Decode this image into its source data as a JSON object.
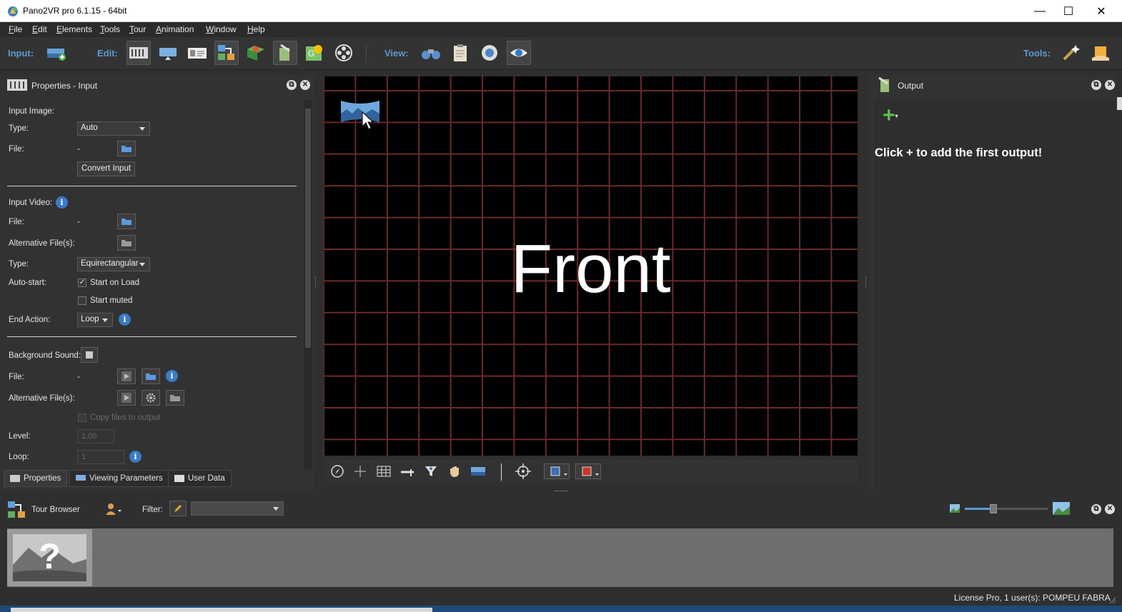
{
  "window": {
    "title": "Pano2VR pro 6.1.15 - 64bit",
    "minimize": "—",
    "maximize": "☐",
    "close": "✕"
  },
  "menu": [
    "File",
    "Edit",
    "Elements",
    "Tools",
    "Tour",
    "Animation",
    "Window",
    "Help"
  ],
  "toolbar": {
    "input_label": "Input:",
    "edit_label": "Edit:",
    "view_label": "View:",
    "tools_label": "Tools:"
  },
  "properties_panel": {
    "title": "Properties - Input",
    "input_image_heading": "Input Image:",
    "type_label": "Type:",
    "type_value": "Auto",
    "file_label": "File:",
    "file_value": "-",
    "convert_button": "Convert Input",
    "input_video_heading": "Input Video:",
    "video_file_label": "File:",
    "video_file_value": "-",
    "alt_files_label": "Alternative File(s):",
    "video_type_label": "Type:",
    "video_type_value": "Equirectangular",
    "autostart_label": "Auto-start:",
    "start_on_load": "Start on Load",
    "start_on_load_checked": true,
    "start_muted": "Start muted",
    "start_muted_checked": false,
    "end_action_label": "End Action:",
    "end_action_value": "Loop",
    "bg_sound_heading": "Background Sound:",
    "sound_file_label": "File:",
    "sound_file_value": "-",
    "sound_alt_label": "Alternative File(s):",
    "copy_files": "Copy files to output",
    "level_label": "Level:",
    "level_value": "1,00",
    "loop_label": "Loop:",
    "loop_value": "1",
    "info_glyph": "i"
  },
  "tabs": [
    "Properties",
    "Viewing Parameters",
    "User Data"
  ],
  "viewer": {
    "face_label": "Front",
    "grid_color": "#6b2a2a"
  },
  "output_panel": {
    "title": "Output",
    "add_button": "+",
    "empty_message": "Click + to add the first output!"
  },
  "tour_browser": {
    "title": "Tour Browser",
    "filter_label": "Filter:",
    "filter_value": "",
    "thumbnail_glyph": "?"
  },
  "status": {
    "license": "License Pro, 1 user(s): POMPEU FABRA"
  },
  "colors": {
    "accent": "#5b9bd5",
    "background": "#2f2f2f",
    "info_blue": "#3a7ac8"
  }
}
